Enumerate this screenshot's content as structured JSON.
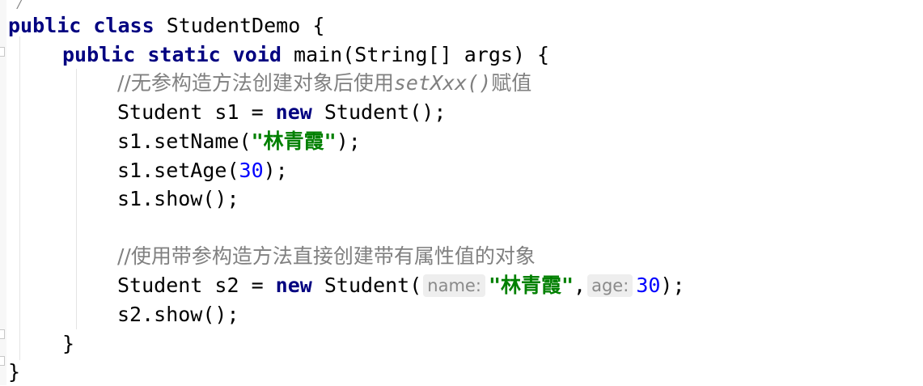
{
  "code": {
    "line1": {
      "kw1": "public",
      "kw2": "class",
      "name": "StudentDemo",
      "brace": "{"
    },
    "line2": {
      "kw1": "public",
      "kw2": "static",
      "kw3": "void",
      "rest": "main(String[] args) {"
    },
    "line3": {
      "comment_prefix": "//无参构造方法创建对象后使用",
      "comment_code": "setXxx()",
      "comment_suffix": "赋值"
    },
    "line4": {
      "type": "Student",
      "rest1": " s1 = ",
      "kw": "new",
      "rest2": " Student();"
    },
    "line5": {
      "call": "s1.setName(",
      "string": "\"林青霞\"",
      "end": ");"
    },
    "line6": {
      "call": "s1.setAge(",
      "number": "30",
      "end": ");"
    },
    "line7": {
      "text": "s1.show();"
    },
    "line9": {
      "comment": "//使用带参构造方法直接创建带有属性值的对象"
    },
    "line10": {
      "type": "Student",
      "rest1": " s2 = ",
      "kw": "new",
      "rest2": " Student(",
      "hint1": "name:",
      "string": "\"林青霞\"",
      "comma": ",",
      "hint2": "age:",
      "number": "30",
      "end": ");"
    },
    "line11": {
      "text": "s2.show();"
    },
    "line12": {
      "text": "}"
    },
    "line13": {
      "text": "}"
    }
  }
}
